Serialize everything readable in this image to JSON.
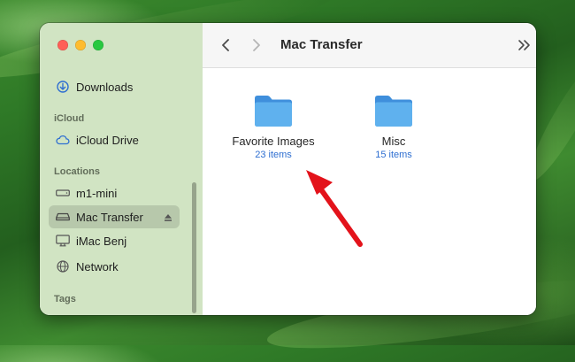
{
  "window": {
    "title": "Mac Transfer"
  },
  "sidebar": {
    "favorites": [
      {
        "label": "Downloads",
        "icon": "download-icon"
      }
    ],
    "icloud_header": "iCloud",
    "icloud": [
      {
        "label": "iCloud Drive",
        "icon": "cloud-icon"
      }
    ],
    "locations_header": "Locations",
    "locations": [
      {
        "label": "m1-mini",
        "icon": "drive-icon",
        "selected": false
      },
      {
        "label": "Mac Transfer",
        "icon": "external-drive-icon",
        "selected": true,
        "eject": true
      },
      {
        "label": "iMac Benj",
        "icon": "imac-icon",
        "selected": false
      },
      {
        "label": "Network",
        "icon": "network-globe-icon",
        "selected": false
      }
    ],
    "tags_header": "Tags"
  },
  "content": {
    "folders": [
      {
        "name": "Favorite Images",
        "count": "23 items"
      },
      {
        "name": "Misc",
        "count": "15 items"
      }
    ]
  },
  "colors": {
    "accent_blue": "#2f6fd1",
    "folder_blue": "#4aa3e8",
    "annotation_arrow": "#e3131b"
  }
}
